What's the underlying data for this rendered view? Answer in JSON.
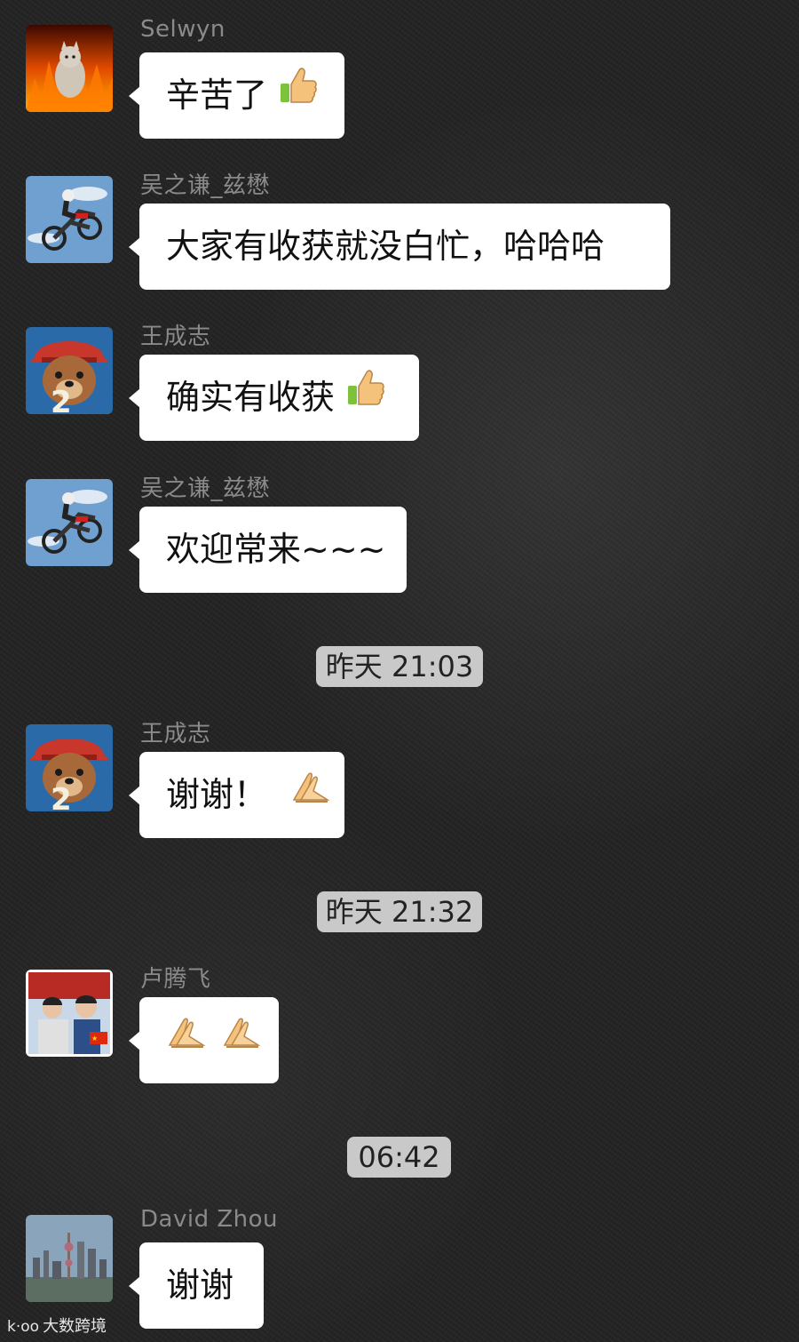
{
  "messages": [
    {
      "sender": "Selwyn",
      "text": "辛苦了",
      "emoji": "thumbs-up-icon",
      "avatar": "fire-cat-avatar"
    },
    {
      "sender": "吴之谦_兹懋",
      "text": "大家有收获就没白忙，哈哈哈",
      "avatar": "motocross-avatar"
    },
    {
      "sender": "王成志",
      "text": "确实有收获",
      "emoji": "thumbs-up-icon",
      "avatar": "bear-avatar"
    },
    {
      "sender": "吴之谦_兹懋",
      "text": "欢迎常来~~~",
      "avatar": "motocross-avatar"
    },
    {
      "sender": "王成志",
      "text": "谢谢！",
      "emoji": "thank-you-hands-icon",
      "avatar": "bear-avatar"
    },
    {
      "sender": "卢腾飞",
      "text": "",
      "emoji": "thank-you-hands-icon x2",
      "avatar": "family-photo-avatar"
    },
    {
      "sender": "David Zhou",
      "text": "谢谢",
      "avatar": "city-skyline-avatar"
    }
  ],
  "timestamps": [
    "昨天 21:03",
    "昨天 21:32",
    "06:42"
  ],
  "watermark": {
    "text": "大数跨境",
    "icon": "k·oo"
  },
  "colors": {
    "bubble": "#ffffff",
    "timestamp_bg": "#c9c9c9",
    "sender_name": "#8a8a8a",
    "background": "#242424"
  }
}
